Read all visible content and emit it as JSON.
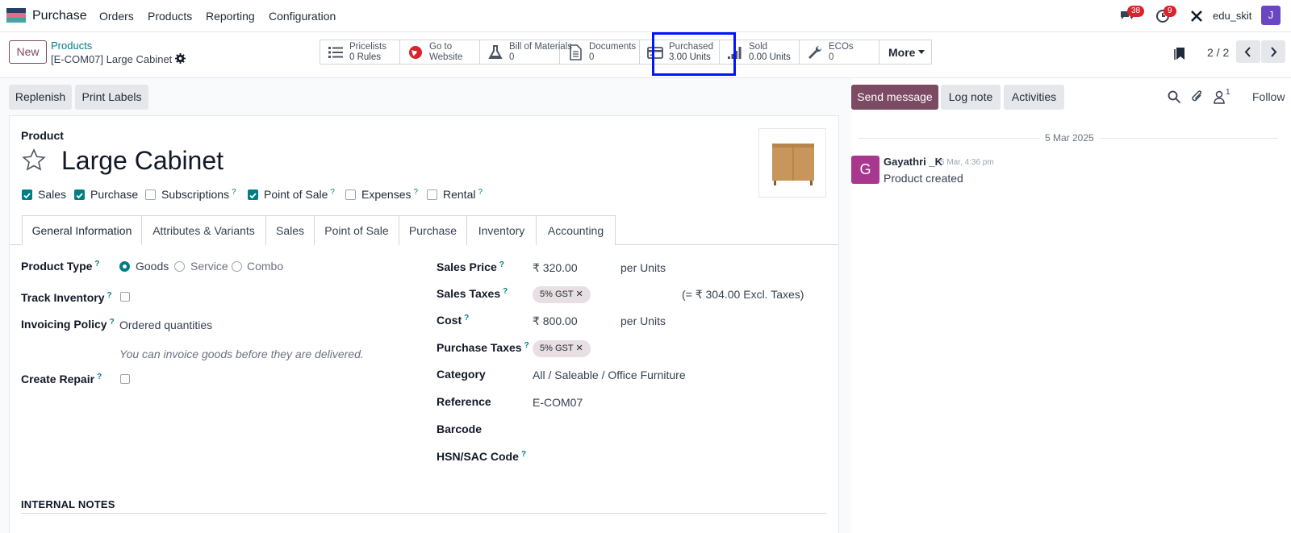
{
  "nav": {
    "app_name": "Purchase",
    "menus": [
      "Orders",
      "Products",
      "Reporting",
      "Configuration"
    ],
    "messages_badge": "38",
    "activities_badge": "9",
    "user_name": "edu_skit",
    "user_initial": "J",
    "logo_colors": [
      "#2c3e66",
      "#e26b8e",
      "#3aa99f"
    ]
  },
  "control": {
    "new_label": "New",
    "breadcrumb_parent": "Products",
    "breadcrumb_current": "[E-COM07] Large Cabinet",
    "smart_buttons": [
      {
        "line1": "Pricelists",
        "line2": "0 Rules",
        "icon": "list-icon"
      },
      {
        "line1": "Go to",
        "line2": "Website",
        "icon": "globe-icon"
      },
      {
        "line1": "Bill of Materials",
        "line2": "0",
        "icon": "flask-icon"
      },
      {
        "line1": "Documents",
        "line2": "0",
        "icon": "file-icon"
      },
      {
        "line1": "Purchased",
        "line2": "3.00 Units",
        "icon": "credit-card-icon"
      },
      {
        "line1": "Sold",
        "line2": "0.00 Units",
        "icon": "signal-icon"
      },
      {
        "line1": "ECOs",
        "line2": "0",
        "icon": "wrench-icon"
      }
    ],
    "more_label": "More",
    "pager": "2 / 2"
  },
  "actions": {
    "replenish": "Replenish",
    "print_labels": "Print Labels",
    "send_message": "Send message",
    "log_note": "Log note",
    "activities": "Activities",
    "followers_count": "1",
    "follow": "Follow"
  },
  "product": {
    "section_label": "Product",
    "name": "Large Cabinet",
    "flags": [
      {
        "label": "Sales",
        "checked": true,
        "help": false
      },
      {
        "label": "Purchase",
        "checked": true,
        "help": false
      },
      {
        "label": "Subscriptions",
        "checked": false,
        "help": true
      },
      {
        "label": "Point of Sale",
        "checked": true,
        "help": true
      },
      {
        "label": "Expenses",
        "checked": false,
        "help": true
      },
      {
        "label": "Rental",
        "checked": false,
        "help": true
      }
    ]
  },
  "tabs": [
    "General Information",
    "Attributes & Variants",
    "Sales",
    "Point of Sale",
    "Purchase",
    "Inventory",
    "Accounting"
  ],
  "general": {
    "product_type_label": "Product Type",
    "product_type_options": [
      "Goods",
      "Service",
      "Combo"
    ],
    "product_type_selected": "Goods",
    "track_inventory_label": "Track Inventory",
    "invoicing_policy_label": "Invoicing Policy",
    "invoicing_policy_value": "Ordered quantities",
    "invoicing_hint": "You can invoice goods before they are delivered.",
    "create_repair_label": "Create Repair",
    "sales_price_label": "Sales Price",
    "sales_price_value": "₹ 320.00",
    "per_units": "per Units",
    "sales_taxes_label": "Sales Taxes",
    "tax_tag": "5% GST",
    "excl_taxes": "(= ₹ 304.00 Excl. Taxes)",
    "cost_label": "Cost",
    "cost_value": "₹ 800.00",
    "purchase_taxes_label": "Purchase Taxes",
    "category_label": "Category",
    "category_value": "All / Saleable / Office Furniture",
    "reference_label": "Reference",
    "reference_value": "E-COM07",
    "barcode_label": "Barcode",
    "hsn_label": "HSN/SAC Code",
    "internal_notes": "INTERNAL NOTES"
  },
  "chatter": {
    "date": "5 Mar 2025",
    "author": "Gayathri _K",
    "author_initial": "G",
    "time": "5 Mar, 4:36 pm",
    "body": "Product created"
  },
  "q_mark": "?"
}
